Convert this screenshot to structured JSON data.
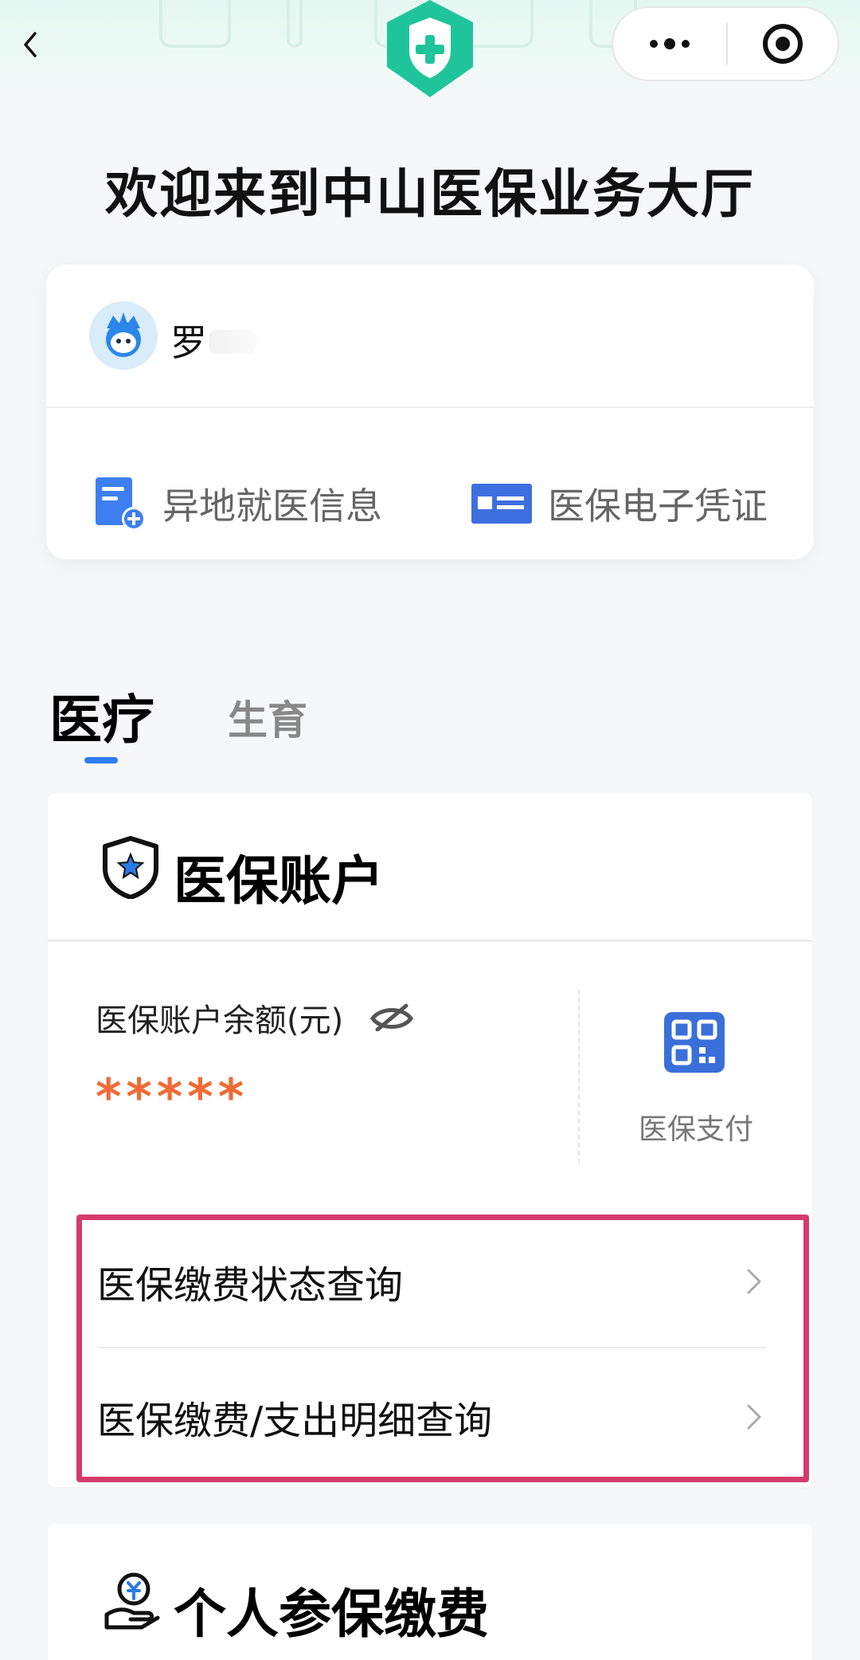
{
  "header": {
    "welcome_title": "欢迎来到中山医保业务大厅"
  },
  "user": {
    "name": "罗"
  },
  "quick_links": [
    {
      "label": "异地就医信息",
      "icon": "document-plus-icon"
    },
    {
      "label": "医保电子凭证",
      "icon": "id-card-icon"
    }
  ],
  "tabs": [
    {
      "label": "医疗",
      "active": true
    },
    {
      "label": "生育",
      "active": false
    }
  ],
  "account": {
    "title": "医保账户",
    "balance_label": "医保账户余额(元)",
    "balance_value": "*****",
    "pay_label": "医保支付"
  },
  "account_links": [
    {
      "label": "医保缴费状态查询"
    },
    {
      "label": "医保缴费/支出明细查询"
    }
  ],
  "personal_payment": {
    "title": "个人参保缴费"
  },
  "colors": {
    "accent": "#2b7ff0",
    "brand_green": "#20c39a",
    "balance_orange": "#f06a35",
    "highlight": "#d43b6c"
  }
}
